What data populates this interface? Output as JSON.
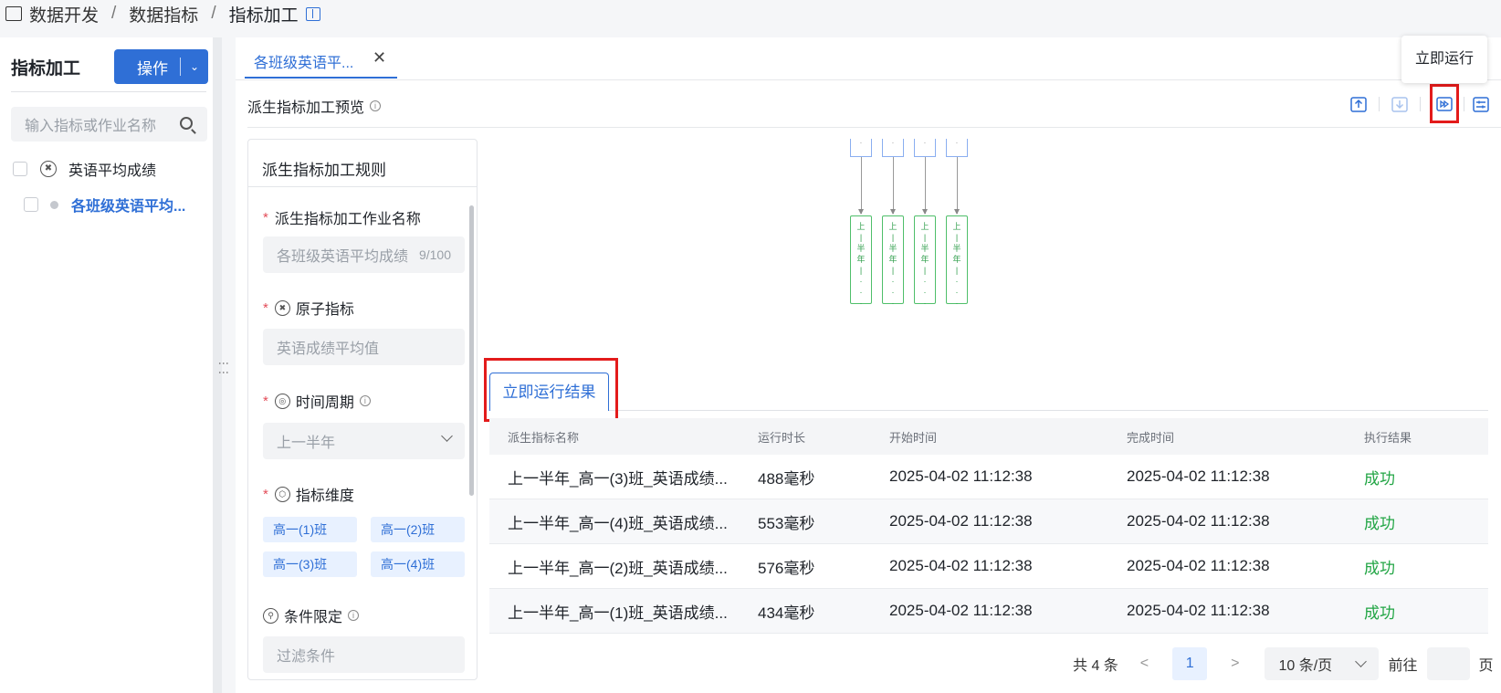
{
  "breadcrumb": {
    "items": [
      "数据开发",
      "数据指标",
      "指标加工"
    ]
  },
  "sidebar": {
    "title": "指标加工",
    "operate_button": "操作",
    "search_placeholder": "输入指标或作业名称",
    "tree": [
      {
        "label": "英语平均成绩"
      },
      {
        "label": "各班级英语平均..."
      }
    ]
  },
  "main": {
    "tab_label": "各班级英语平...",
    "section_title": "派生指标加工预览",
    "tooltip": "立即运行",
    "toolbar_icons": [
      "upload-icon",
      "download-icon",
      "run-now-icon",
      "settings-icon"
    ]
  },
  "rules": {
    "title": "派生指标加工规则",
    "job_name_label": "派生指标加工作业名称",
    "job_name_value": "各班级英语平均成绩",
    "job_name_count": "9/100",
    "atomic_label": "原子指标",
    "atomic_value": "英语成绩平均值",
    "period_label": "时间周期",
    "period_value": "上一半年",
    "dimension_label": "指标维度",
    "dimensions": [
      "高一(1)班",
      "高一(2)班",
      "高一(3)班",
      "高一(4)班"
    ],
    "condition_label": "条件限定",
    "condition_placeholder": "过滤条件"
  },
  "graph": {
    "top_nodes": [
      "·",
      "·",
      "·",
      "·"
    ],
    "nodes": [
      "上\n|\n半\n年\n|\n·\n·\n·",
      "上\n|\n半\n年\n|\n·\n·\n·",
      "上\n|\n半\n年\n|\n·\n·\n·",
      "上\n|\n半\n年\n|\n·\n·\n·"
    ]
  },
  "results": {
    "tab_label": "立即运行结果",
    "columns": [
      "派生指标名称",
      "运行时长",
      "开始时间",
      "完成时间",
      "执行结果"
    ],
    "rows": [
      [
        "上一半年_高一(3)班_英语成绩...",
        "488毫秒",
        "2025-04-02 11:12:38",
        "2025-04-02 11:12:38",
        "成功"
      ],
      [
        "上一半年_高一(4)班_英语成绩...",
        "553毫秒",
        "2025-04-02 11:12:38",
        "2025-04-02 11:12:38",
        "成功"
      ],
      [
        "上一半年_高一(2)班_英语成绩...",
        "576毫秒",
        "2025-04-02 11:12:38",
        "2025-04-02 11:12:38",
        "成功"
      ],
      [
        "上一半年_高一(1)班_英语成绩...",
        "434毫秒",
        "2025-04-02 11:12:38",
        "2025-04-02 11:12:38",
        "成功"
      ]
    ]
  },
  "pagination": {
    "total": "共 4 条",
    "current_page": "1",
    "page_size": "10 条/页",
    "goto_label": "前往",
    "page_suffix": "页"
  }
}
